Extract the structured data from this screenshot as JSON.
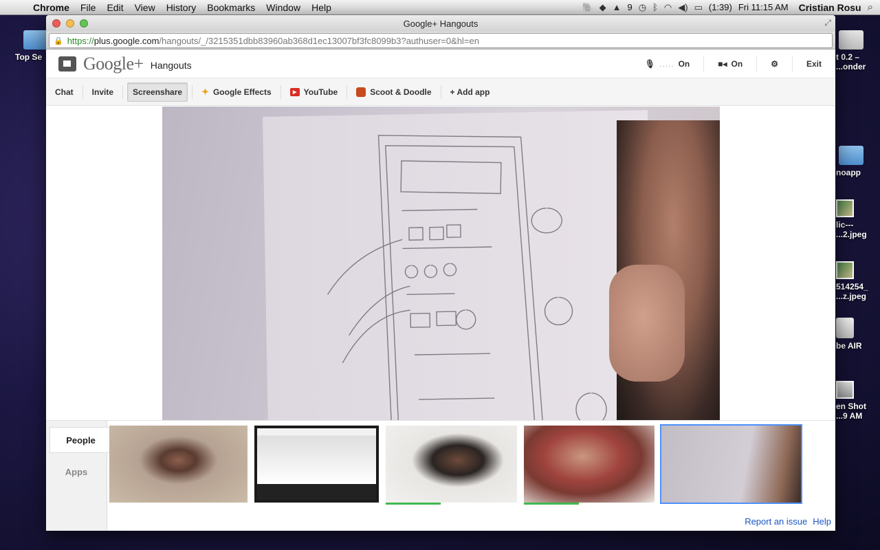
{
  "menubar": {
    "app": "Chrome",
    "items": [
      "File",
      "Edit",
      "View",
      "History",
      "Bookmarks",
      "Window",
      "Help"
    ],
    "adobe_count": "9",
    "battery": "(1:39)",
    "clock": "Fri 11:15 AM",
    "user": "Cristian Rosu"
  },
  "desktop": {
    "left_folder": "Top Se",
    "r1": "t 0.2 –",
    "r1b": "...onder",
    "r2": "noapp",
    "r3a": "lic---",
    "r3b": "...2.jpeg",
    "r4a": "514254_",
    "r4b": "...z.jpeg",
    "r5": "be AIR",
    "r6a": "en Shot",
    "r6b": "...9 AM"
  },
  "window": {
    "title": "Google+ Hangouts",
    "url_scheme": "https://",
    "url_host": "plus.google.com",
    "url_path": "/hangouts/_/3215351dbb83960ab368d1ec13007bf3fc8099b3?authuser=0&hl=en"
  },
  "header": {
    "brand": "Google+",
    "product": "Hangouts",
    "mic_dots": ".....",
    "mic_state": "On",
    "cam_state": "On",
    "exit": "Exit"
  },
  "toolbar": {
    "chat": "Chat",
    "invite": "Invite",
    "screenshare": "Screenshare",
    "effects": "Google Effects",
    "youtube": "YouTube",
    "scoot": "Scoot & Doodle",
    "add_app": "+ Add app"
  },
  "filmstrip": {
    "tabs": [
      "People",
      "Apps"
    ]
  },
  "footer": {
    "report": "Report an issue",
    "help": "Help"
  }
}
